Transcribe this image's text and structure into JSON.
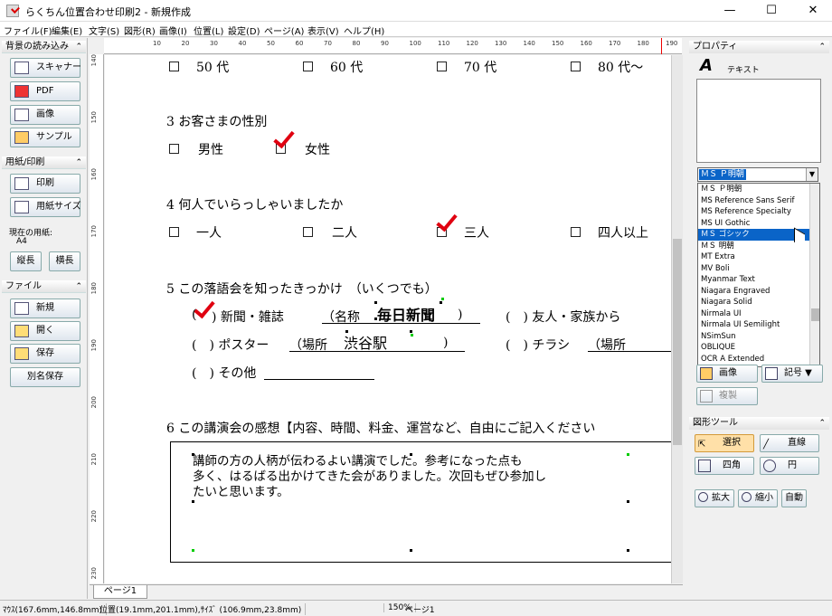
{
  "window": {
    "title": "らくちん位置合わせ印刷2 - 新規作成",
    "min": "—",
    "max": "☐",
    "close": "✕"
  },
  "menu": [
    "ファイル(F)",
    "編集(E)",
    "文字(S)",
    "図形(R)",
    "画像(I)",
    "位置(L)",
    "設定(D)",
    "ページ(A)",
    "表示(V)",
    "ヘルプ(H)"
  ],
  "left": {
    "bg_header": "背景の読み込み",
    "scanner": "スキャナー",
    "pdf": "PDF",
    "image": "画像",
    "sample": "サンプル",
    "print_header": "用紙/印刷",
    "print": "印刷",
    "paper_size": "用紙サイズ",
    "current_paper_label": "現在の用紙:",
    "current_paper": "A4",
    "portrait": "縦長",
    "landscape": "横長",
    "file_header": "ファイル",
    "new": "新規",
    "open": "開く",
    "save": "保存",
    "save_as": "別名保存",
    "collapse": "⌃"
  },
  "ruler": {
    "top": [
      "10",
      "20",
      "30",
      "40",
      "50",
      "60",
      "70",
      "80",
      "90",
      "100",
      "110",
      "120",
      "130",
      "140",
      "150",
      "160",
      "170",
      "180",
      "190"
    ],
    "left": [
      "140",
      "150",
      "160",
      "170",
      "180",
      "190",
      "200",
      "210",
      "220",
      "230"
    ]
  },
  "doc": {
    "q2_opts": [
      "50 代",
      "60 代",
      "70 代",
      "80 代～"
    ],
    "q3": "3 お客さまの性別",
    "q3_opts": [
      "男性",
      "女性"
    ],
    "q4": "4 何人でいらっしゃいましたか",
    "q4_opts": [
      "一人",
      "二人",
      "三人",
      "四人以上"
    ],
    "q5": "5 この落語会を知ったきっかけ　（いくつでも）",
    "q5_row1a": ")  新聞・雑誌",
    "q5_name": "（名称",
    "q5_name_val": "毎日新聞",
    "q5_close": ")",
    "q5_row1b": "(　)  友人・家族から",
    "q5_row2a": "(　)  ポスター",
    "q5_place": "（場所",
    "q5_place_val": "渋谷駅",
    "q5_close2": ")",
    "q5_row2b": "(　)  チラシ",
    "q5_place2": "（場所",
    "q5_row3": "(　)  その他",
    "q6": "6 この講演会の感想【内容、時間、料金、運営など、自由にご記入ください",
    "free_text": [
      "講師の方の人柄が伝わるよい講演でした。参考になった点も",
      "多く、はるばる出かけてきた会がありました。次回もぜひ参加し",
      "たいと思います。"
    ]
  },
  "page_tab": "ページ1",
  "status": {
    "mouse": "ﾏｳｽ(167.6mm,146.8mm)",
    "pos": "位置(19.1mm,201.1mm),ｻｲｽﾞ (106.9mm,23.8mm)",
    "zoom": "150%",
    "page": "ページ1"
  },
  "right": {
    "prop_header": "プロパティ",
    "text_label": "テキスト",
    "font_selected": "ＭＳ Ｐ明朝",
    "fonts": [
      "ＭＳ Ｐ明朝",
      "MS Reference Sans Serif",
      "MS Reference Specialty",
      "MS UI Gothic",
      "ＭＳ ゴシック",
      "ＭＳ 明朝",
      "MT Extra",
      "MV Boli",
      "Myanmar Text",
      "Niagara Engraved",
      "Niagara Solid",
      "Nirmala UI",
      "Nirmala UI Semilight",
      "NSimSun",
      "OBLIQUE",
      "OCR A Extended"
    ],
    "font_highlight_index": 4,
    "image_btn": "画像",
    "symbol_btn": "記号 ▼",
    "copy_btn": "複製",
    "shape_header": "図形ツール",
    "select": "選択",
    "line": "直線",
    "rect": "四角",
    "circle": "円",
    "zoom_in": "拡大",
    "zoom_out": "縮小",
    "auto": "自動"
  }
}
